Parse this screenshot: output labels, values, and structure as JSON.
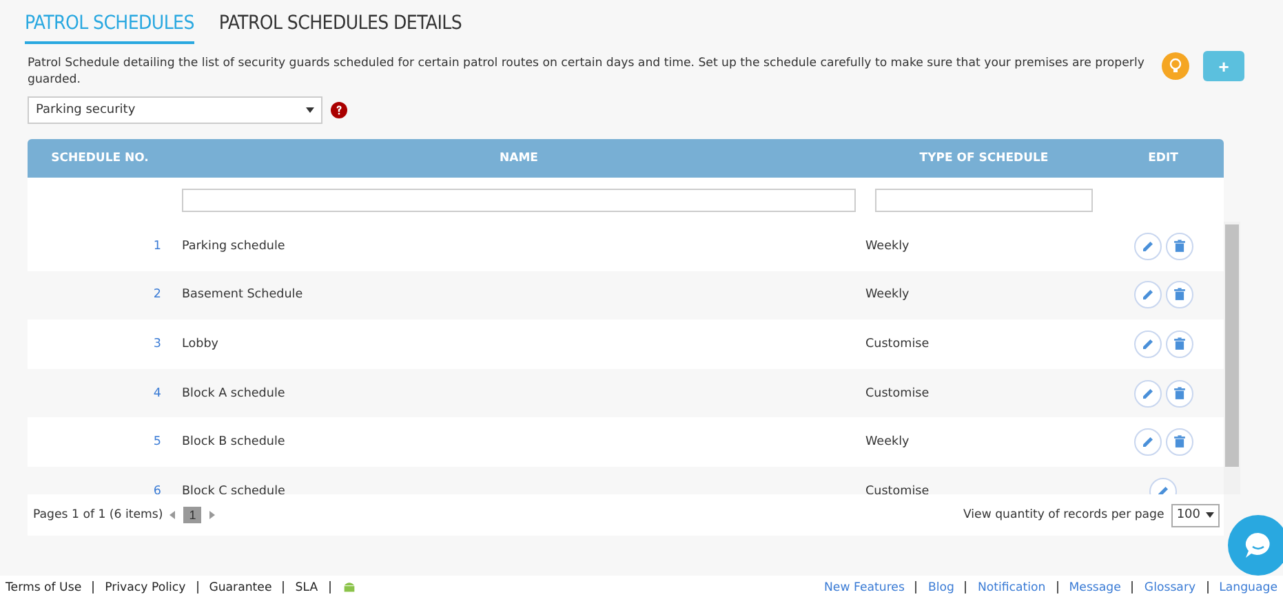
{
  "tabs": [
    {
      "label": "PATROL SCHEDULES",
      "selected": true
    },
    {
      "label": "PATROL SCHEDULES DETAILS",
      "selected": false
    }
  ],
  "description": "Patrol Schedule detailing the list of security guards scheduled for certain patrol routes on certain days and time. Set up the schedule carefully to make sure that your premises are properly guarded.",
  "add_button": "+",
  "route_select": {
    "value": "Parking security"
  },
  "table": {
    "columns": [
      "SCHEDULE NO.",
      "NAME",
      "TYPE OF SCHEDULE",
      "EDIT"
    ],
    "rows": [
      {
        "number": "1",
        "name": "Parking schedule",
        "type": "Weekly",
        "delete_button": true
      },
      {
        "number": "2",
        "name": "Basement Schedule",
        "type": "Weekly",
        "delete_button": true
      },
      {
        "number": "3",
        "name": "Lobby",
        "type": "Customise",
        "delete_button": true
      },
      {
        "number": "4",
        "name": "Block A schedule",
        "type": "Customise",
        "delete_button": true
      },
      {
        "number": "5",
        "name": "Block B schedule",
        "type": "Weekly",
        "delete_button": true
      },
      {
        "number": "6",
        "name": "Block C schedule",
        "type": "Customise",
        "delete_button": false
      }
    ]
  },
  "pager": {
    "summary": "Pages 1 of 1 (6 items)",
    "pages": [
      {
        "label": "1",
        "selected": true
      }
    ],
    "per_page_label": "View quantity of records per page",
    "per_page": "100"
  },
  "footer": {
    "left": [
      "Terms of Use",
      "Privacy Policy",
      "Guarantee",
      "SLA"
    ],
    "right": [
      "New Features",
      "Blog",
      "Notification",
      "Message",
      "Glossary",
      "Language"
    ]
  }
}
